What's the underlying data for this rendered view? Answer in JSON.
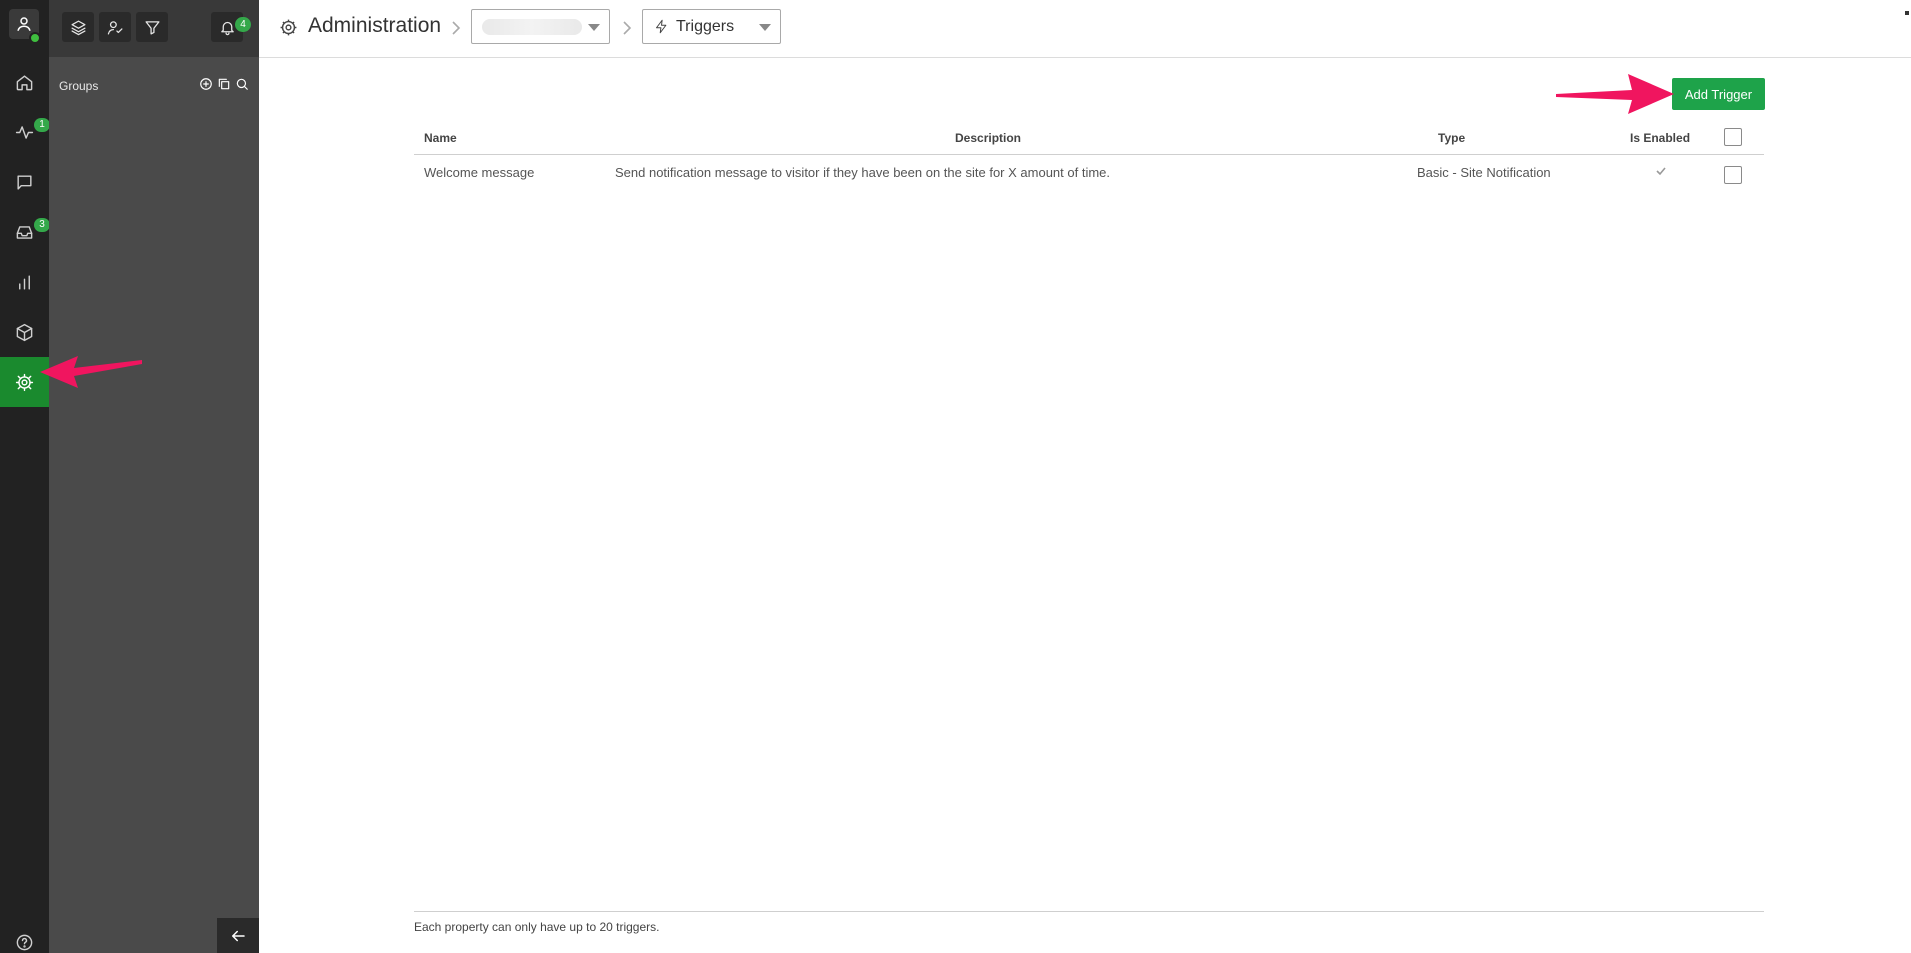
{
  "rail": {
    "badges": {
      "activity": "1",
      "inbox": "3"
    },
    "items": [
      {
        "name": "home",
        "icon": "home-icon"
      },
      {
        "name": "activity",
        "icon": "activity-icon"
      },
      {
        "name": "chat",
        "icon": "chat-icon"
      },
      {
        "name": "inbox",
        "icon": "inbox-icon"
      },
      {
        "name": "reports",
        "icon": "bar-chart-icon"
      },
      {
        "name": "integrations",
        "icon": "box-icon"
      },
      {
        "name": "administration",
        "icon": "gear-icon",
        "active": true
      },
      {
        "name": "help",
        "icon": "help-icon"
      }
    ]
  },
  "panel": {
    "notification_count": "4",
    "groups_label": "Groups"
  },
  "header": {
    "title": "Administration",
    "property_select_value": "",
    "section_select_value": "Triggers"
  },
  "actions": {
    "add_trigger_label": "Add Trigger"
  },
  "table": {
    "columns": {
      "name": "Name",
      "description": "Description",
      "type": "Type",
      "enabled": "Is Enabled"
    },
    "rows": [
      {
        "name": "Welcome message",
        "description": "Send notification message to visitor if they have been on the site for X amount of time.",
        "type": "Basic - Site Notification",
        "enabled": true
      }
    ]
  },
  "footer": {
    "note": "Each property can only have up to 20 triggers."
  },
  "colors": {
    "accent_green": "#1ea34a",
    "rail_active": "#1a8a2e",
    "annotation_arrow": "#f0155f"
  }
}
